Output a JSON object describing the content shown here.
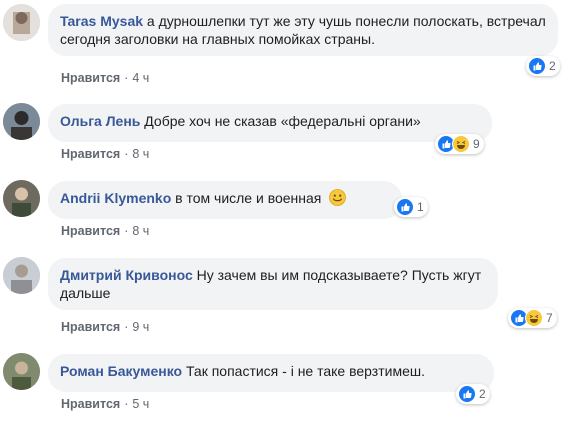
{
  "actions": {
    "like_label": "Нравится",
    "separator": "·"
  },
  "comments": [
    {
      "author": "Taras Mysak",
      "text": "а дурношлепки тут же эту чушь понесли полоскать, встречал сегодня заголовки на главных помойках страны.",
      "time": "4 ч",
      "reaction_count": "2",
      "reactions": [
        "like"
      ]
    },
    {
      "author": "Ольга Лень",
      "text": "Добре хоч не сказав «федеральні органи»",
      "time": "8 ч",
      "reaction_count": "9",
      "reactions": [
        "like",
        "haha"
      ]
    },
    {
      "author": "Andrii Klymenko",
      "text": "в том числе и военная",
      "time": "8 ч",
      "reaction_count": "1",
      "reactions": [
        "like"
      ]
    },
    {
      "author": "Дмитрий Кривонос",
      "text": "Ну зачем вы им подсказываете? Пусть жгут дальше",
      "time": "9 ч",
      "reaction_count": "7",
      "reactions": [
        "like",
        "haha"
      ]
    },
    {
      "author": "Роман Бакуменко",
      "text": "Так попастися - і не таке верзтимеш.",
      "time": "5 ч",
      "reaction_count": "2",
      "reactions": [
        "like"
      ]
    }
  ],
  "colors": {
    "author": "#385898",
    "bubble": "#f2f3f5",
    "meta": "#606770",
    "like_blue": "#1877f2",
    "haha_yellow": "#f7c83a"
  }
}
